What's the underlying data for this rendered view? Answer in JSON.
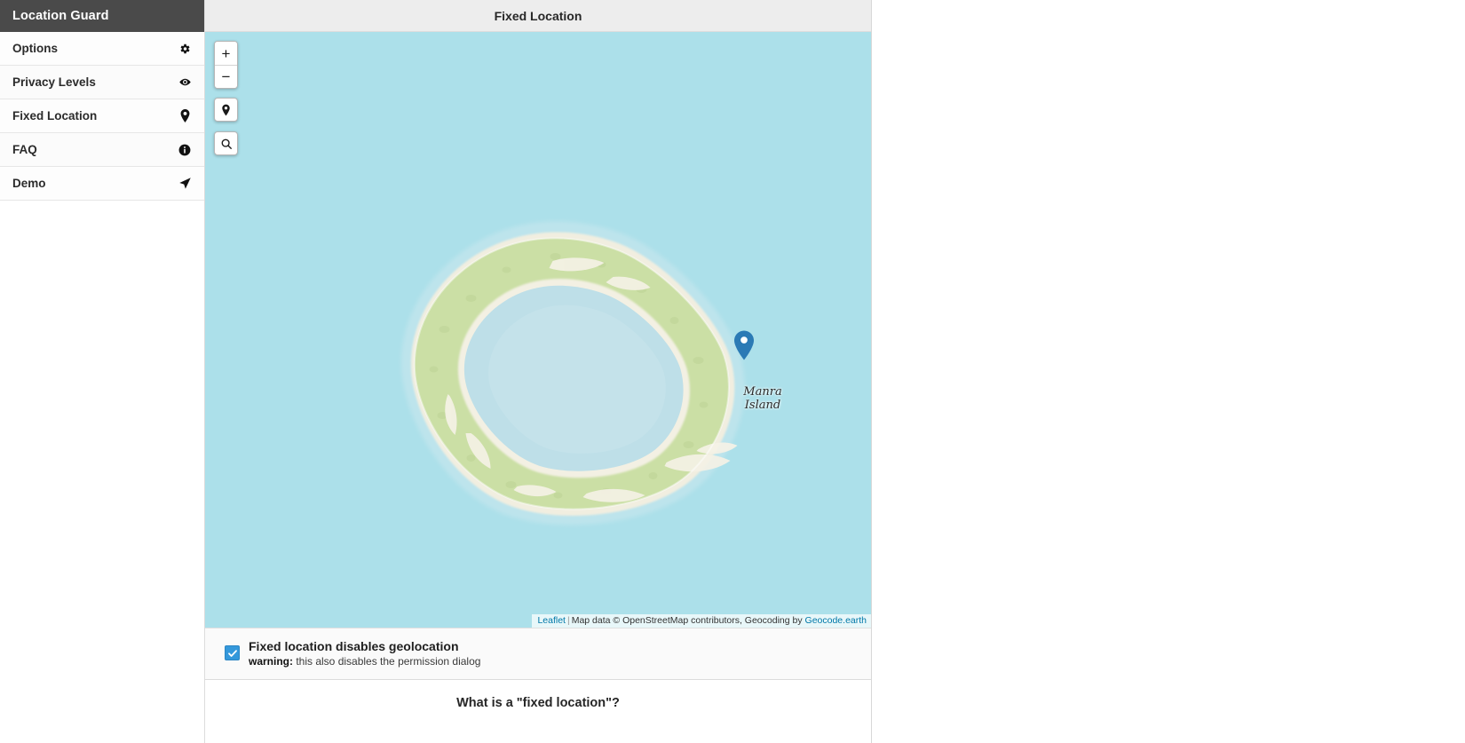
{
  "sidebar": {
    "title": "Location Guard",
    "items": [
      {
        "label": "Options",
        "icon": "gear-icon"
      },
      {
        "label": "Privacy Levels",
        "icon": "eye-icon"
      },
      {
        "label": "Fixed Location",
        "icon": "map-pin-icon"
      },
      {
        "label": "FAQ",
        "icon": "info-icon"
      },
      {
        "label": "Demo",
        "icon": "navigation-arrow-icon"
      }
    ]
  },
  "content": {
    "title": "Fixed Location"
  },
  "map": {
    "zoom_in_label": "+",
    "zoom_out_label": "−",
    "locate_icon": "map-pin-icon",
    "search_icon": "search-icon",
    "place_label_line1": "Manra",
    "place_label_line2": "Island",
    "marker_icon": "location-marker-pin",
    "attribution": {
      "leaflet": "Leaflet",
      "separator": "|",
      "map_data": "Map data © OpenStreetMap contributors, Geocoding by",
      "geocoder": "Geocode.earth"
    },
    "colors": {
      "ocean": "#ace0ea",
      "lagoon": "#b9dfe8",
      "land": "#cbdfa5",
      "beach": "#f3f0e3",
      "marker": "#2b7ab5"
    }
  },
  "option": {
    "checked": true,
    "check_glyph": "✔",
    "title": "Fixed location disables geolocation",
    "warning_label": "warning:",
    "warning_text": " this also disables the permission dialog"
  },
  "section": {
    "heading": "What is a \"fixed location\"?"
  }
}
